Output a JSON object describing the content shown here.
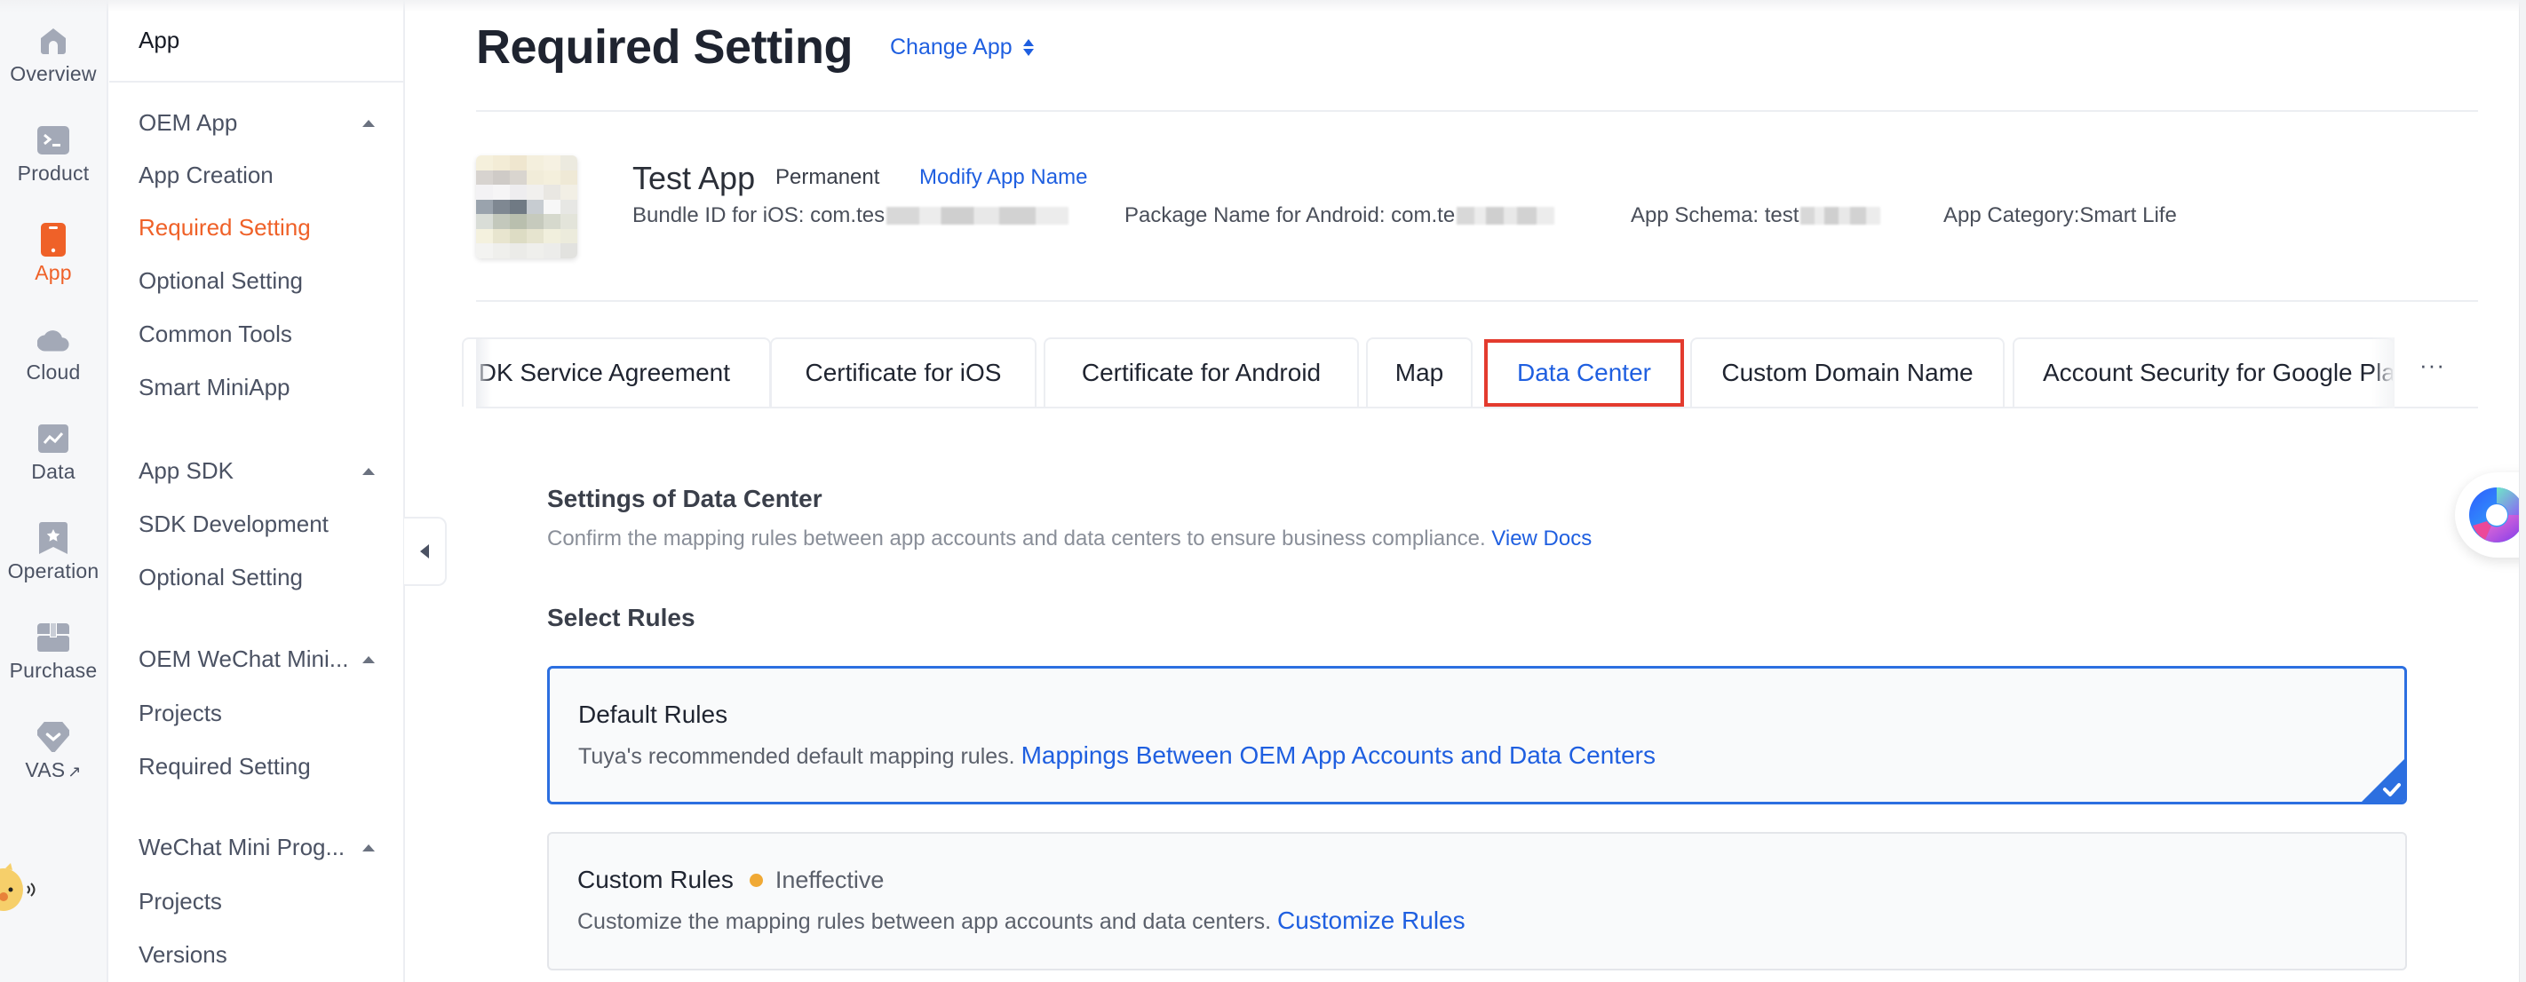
{
  "rail": {
    "items": [
      {
        "label": "Overview",
        "icon": "home-icon"
      },
      {
        "label": "Product",
        "icon": "terminal-icon"
      },
      {
        "label": "App",
        "icon": "phone-icon",
        "active": true
      },
      {
        "label": "Cloud",
        "icon": "cloud-icon"
      },
      {
        "label": "Data",
        "icon": "chart-icon"
      },
      {
        "label": "Operation",
        "icon": "bookmark-star-icon"
      },
      {
        "label": "Purchase",
        "icon": "box-icon"
      },
      {
        "label": "VAS",
        "icon": "vas-diamond-icon",
        "external": true
      }
    ],
    "external_mark": "↗"
  },
  "subnav": {
    "header": "App",
    "groups": [
      {
        "label": "OEM App",
        "items": [
          "App Creation",
          "Required Setting",
          "Optional Setting",
          "Common Tools",
          "Smart MiniApp"
        ]
      },
      {
        "label": "App SDK",
        "items": [
          "SDK Development",
          "Optional Setting"
        ]
      },
      {
        "label": "OEM WeChat Mini...",
        "items": [
          "Projects",
          "Required Setting"
        ]
      },
      {
        "label": "WeChat Mini Prog...",
        "items": [
          "Projects",
          "Versions"
        ]
      }
    ],
    "active_item": "Required Setting"
  },
  "header": {
    "title": "Required Setting",
    "change_app": "Change App"
  },
  "app": {
    "name": "Test App",
    "badge": "Permanent",
    "modify_link": "Modify App Name",
    "bundle_ios_label": "Bundle ID for iOS: com.tes",
    "package_android_label": "Package Name for Android: com.te",
    "schema_label": "App Schema: test",
    "category_label": "App Category:Smart Life"
  },
  "tabs": {
    "items": [
      "DK Service Agreement",
      "Certificate for iOS",
      "Certificate for Android",
      "Map",
      "Data Center",
      "Custom Domain Name",
      "Account Security for Google Pla"
    ],
    "active": "Data Center",
    "more": "···"
  },
  "data_center": {
    "title": "Settings of Data Center",
    "description": "Confirm the mapping rules between app accounts and data centers to ensure business compliance.",
    "docs_link": "View Docs",
    "select_rules_title": "Select Rules",
    "rules": [
      {
        "name": "Default Rules",
        "description": "Tuya's recommended default mapping rules.",
        "link": "Mappings Between OEM App Accounts and Data Centers",
        "selected": true
      },
      {
        "name": "Custom Rules",
        "status": "Ineffective",
        "status_color": "#f0a935",
        "description": "Customize the mapping rules between app accounts and data centers.",
        "link": "Customize Rules",
        "selected": false
      }
    ]
  },
  "colors": {
    "accent_orange": "#ef6128",
    "link_blue": "#1f5fe0",
    "selected_border": "#2c6fe0",
    "highlight_red": "#e33b2e"
  }
}
